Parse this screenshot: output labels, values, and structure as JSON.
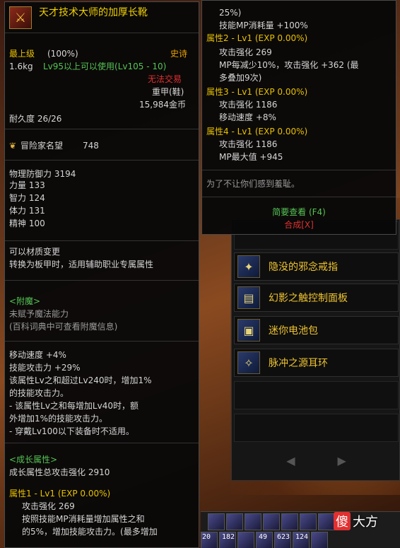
{
  "left_tooltip": {
    "item_name": "天才技术大师的加厚长靴",
    "rarity_label": "最上级",
    "rarity_percent": "(100%)",
    "grade": "史诗",
    "weight": "1.6kg",
    "level_req": "Lv95以上可以使用(Lv105 - 10)",
    "trade": "无法交易",
    "armor_type": "重甲(鞋)",
    "price": "15,984金币",
    "durability": "耐久度 26/26",
    "fame_label": "冒险家名望",
    "fame_value": "748",
    "stats": [
      "物理防御力 3194",
      "力量 133",
      "智力 124",
      "体力 131",
      "精神 100"
    ],
    "transmute": [
      "可以材质变更",
      "转换为板甲时，适用辅助职业专属属性"
    ],
    "enchant_header": "<附魔>",
    "enchant_lines": [
      "未赋予魔法能力",
      "(百科词典中可查看附魔信息)"
    ],
    "effects": [
      "移动速度 +4%",
      "技能攻击力 +29%",
      "该属性Lv之和超过Lv240时，增加1%",
      "的技能攻击力。",
      "- 该属性Lv之和每增加Lv40时，额",
      "外增加1%的技能攻击力。",
      "- 穿戴Lv100以下装备时不适用。"
    ],
    "growth_header": "<成长属性>",
    "growth_total": "成长属性总攻击强化 2910",
    "growth_lines": [
      "属性1 - Lv1 (EXP 0.00%)",
      "攻击强化 269",
      "按照技能MP消耗量增加属性之和",
      "的5%，增加技能攻击力。(最多增加"
    ]
  },
  "right_tooltip": {
    "lines": [
      "25%)",
      "技能MP消耗量 +100%",
      "属性2 - Lv1 (EXP 0.00%)",
      "攻击强化 269",
      "MP每减少10%，攻击强化 +362 (最",
      "多叠加9次)",
      "属性3 - Lv1 (EXP 0.00%)",
      "攻击强化 1186",
      "移动速度 +8%",
      "属性4 - Lv1 (EXP 0.00%)",
      "攻击强化 1186",
      "MP最大值 +945"
    ],
    "flavor": "为了不让你们感到羞耻。",
    "quick_view": "简要查看 (F4)",
    "synthesis": "合成[X]"
  },
  "inventory": {
    "items": [
      {
        "label": "隐没的邪念戒指",
        "icon": "ring-icon"
      },
      {
        "label": "幻影之触控制面板",
        "icon": "panel-icon"
      },
      {
        "label": "迷你电池包",
        "icon": "battery-icon"
      },
      {
        "label": "脉冲之源耳环",
        "icon": "earring-icon"
      }
    ],
    "prev": "◀",
    "next": "▶"
  },
  "skillbar": {
    "counts": [
      "20",
      "182",
      "49",
      "623",
      "124"
    ]
  },
  "watermark": {
    "part1": "傻",
    "part2": "大方"
  }
}
